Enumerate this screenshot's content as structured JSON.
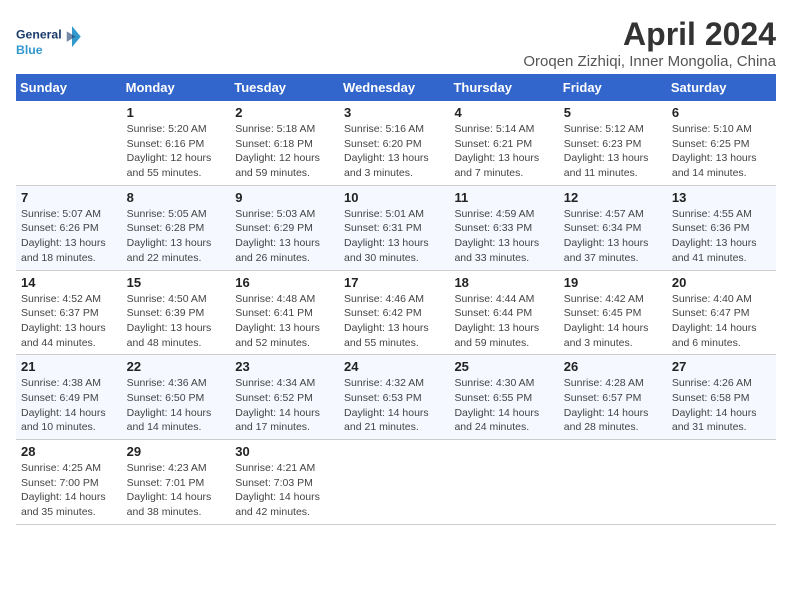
{
  "logo": {
    "general": "General",
    "blue": "Blue"
  },
  "title": "April 2024",
  "subtitle": "Oroqen Zizhiqi, Inner Mongolia, China",
  "days_of_week": [
    "Sunday",
    "Monday",
    "Tuesday",
    "Wednesday",
    "Thursday",
    "Friday",
    "Saturday"
  ],
  "weeks": [
    [
      {
        "day": "",
        "info": ""
      },
      {
        "day": "1",
        "info": "Sunrise: 5:20 AM\nSunset: 6:16 PM\nDaylight: 12 hours\nand 55 minutes."
      },
      {
        "day": "2",
        "info": "Sunrise: 5:18 AM\nSunset: 6:18 PM\nDaylight: 12 hours\nand 59 minutes."
      },
      {
        "day": "3",
        "info": "Sunrise: 5:16 AM\nSunset: 6:20 PM\nDaylight: 13 hours\nand 3 minutes."
      },
      {
        "day": "4",
        "info": "Sunrise: 5:14 AM\nSunset: 6:21 PM\nDaylight: 13 hours\nand 7 minutes."
      },
      {
        "day": "5",
        "info": "Sunrise: 5:12 AM\nSunset: 6:23 PM\nDaylight: 13 hours\nand 11 minutes."
      },
      {
        "day": "6",
        "info": "Sunrise: 5:10 AM\nSunset: 6:25 PM\nDaylight: 13 hours\nand 14 minutes."
      }
    ],
    [
      {
        "day": "7",
        "info": "Sunrise: 5:07 AM\nSunset: 6:26 PM\nDaylight: 13 hours\nand 18 minutes."
      },
      {
        "day": "8",
        "info": "Sunrise: 5:05 AM\nSunset: 6:28 PM\nDaylight: 13 hours\nand 22 minutes."
      },
      {
        "day": "9",
        "info": "Sunrise: 5:03 AM\nSunset: 6:29 PM\nDaylight: 13 hours\nand 26 minutes."
      },
      {
        "day": "10",
        "info": "Sunrise: 5:01 AM\nSunset: 6:31 PM\nDaylight: 13 hours\nand 30 minutes."
      },
      {
        "day": "11",
        "info": "Sunrise: 4:59 AM\nSunset: 6:33 PM\nDaylight: 13 hours\nand 33 minutes."
      },
      {
        "day": "12",
        "info": "Sunrise: 4:57 AM\nSunset: 6:34 PM\nDaylight: 13 hours\nand 37 minutes."
      },
      {
        "day": "13",
        "info": "Sunrise: 4:55 AM\nSunset: 6:36 PM\nDaylight: 13 hours\nand 41 minutes."
      }
    ],
    [
      {
        "day": "14",
        "info": "Sunrise: 4:52 AM\nSunset: 6:37 PM\nDaylight: 13 hours\nand 44 minutes."
      },
      {
        "day": "15",
        "info": "Sunrise: 4:50 AM\nSunset: 6:39 PM\nDaylight: 13 hours\nand 48 minutes."
      },
      {
        "day": "16",
        "info": "Sunrise: 4:48 AM\nSunset: 6:41 PM\nDaylight: 13 hours\nand 52 minutes."
      },
      {
        "day": "17",
        "info": "Sunrise: 4:46 AM\nSunset: 6:42 PM\nDaylight: 13 hours\nand 55 minutes."
      },
      {
        "day": "18",
        "info": "Sunrise: 4:44 AM\nSunset: 6:44 PM\nDaylight: 13 hours\nand 59 minutes."
      },
      {
        "day": "19",
        "info": "Sunrise: 4:42 AM\nSunset: 6:45 PM\nDaylight: 14 hours\nand 3 minutes."
      },
      {
        "day": "20",
        "info": "Sunrise: 4:40 AM\nSunset: 6:47 PM\nDaylight: 14 hours\nand 6 minutes."
      }
    ],
    [
      {
        "day": "21",
        "info": "Sunrise: 4:38 AM\nSunset: 6:49 PM\nDaylight: 14 hours\nand 10 minutes."
      },
      {
        "day": "22",
        "info": "Sunrise: 4:36 AM\nSunset: 6:50 PM\nDaylight: 14 hours\nand 14 minutes."
      },
      {
        "day": "23",
        "info": "Sunrise: 4:34 AM\nSunset: 6:52 PM\nDaylight: 14 hours\nand 17 minutes."
      },
      {
        "day": "24",
        "info": "Sunrise: 4:32 AM\nSunset: 6:53 PM\nDaylight: 14 hours\nand 21 minutes."
      },
      {
        "day": "25",
        "info": "Sunrise: 4:30 AM\nSunset: 6:55 PM\nDaylight: 14 hours\nand 24 minutes."
      },
      {
        "day": "26",
        "info": "Sunrise: 4:28 AM\nSunset: 6:57 PM\nDaylight: 14 hours\nand 28 minutes."
      },
      {
        "day": "27",
        "info": "Sunrise: 4:26 AM\nSunset: 6:58 PM\nDaylight: 14 hours\nand 31 minutes."
      }
    ],
    [
      {
        "day": "28",
        "info": "Sunrise: 4:25 AM\nSunset: 7:00 PM\nDaylight: 14 hours\nand 35 minutes."
      },
      {
        "day": "29",
        "info": "Sunrise: 4:23 AM\nSunset: 7:01 PM\nDaylight: 14 hours\nand 38 minutes."
      },
      {
        "day": "30",
        "info": "Sunrise: 4:21 AM\nSunset: 7:03 PM\nDaylight: 14 hours\nand 42 minutes."
      },
      {
        "day": "",
        "info": ""
      },
      {
        "day": "",
        "info": ""
      },
      {
        "day": "",
        "info": ""
      },
      {
        "day": "",
        "info": ""
      }
    ]
  ]
}
